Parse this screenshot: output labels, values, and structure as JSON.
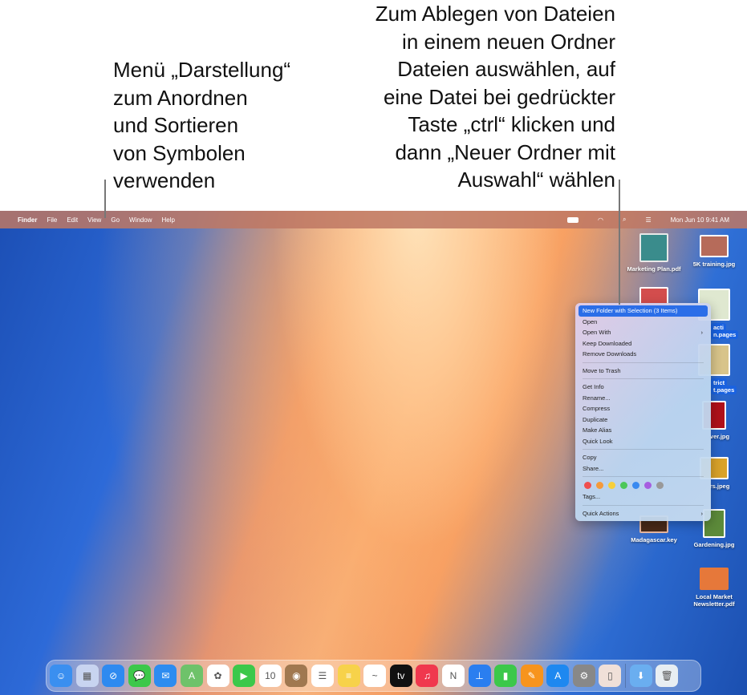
{
  "callouts": {
    "left": [
      "Menü „Darstellung“",
      "zum Anordnen",
      "und Sortieren",
      "von Symbolen",
      "verwenden"
    ],
    "right": [
      "Zum Ablegen von Dateien",
      "in einem neuen Ordner",
      "Dateien auswählen, auf",
      "eine Datei bei gedrückter",
      "Taste „ctrl“ klicken und",
      "dann „Neuer Ordner mit",
      "Auswahl“ wählen"
    ]
  },
  "menubar": {
    "apple": "",
    "app": "Finder",
    "items": [
      "File",
      "Edit",
      "View",
      "Go",
      "Window",
      "Help"
    ],
    "clock": "Mon Jun 10  9:41 AM"
  },
  "desktop_icons": [
    {
      "label": "Marketing Plan.pdf",
      "color": "#3a8c8c"
    },
    {
      "label": "5K training.jpg",
      "color": "#b66b5a"
    },
    {
      "label": "",
      "color": "#d34d4d"
    },
    {
      "label1": "acti",
      "label2": "n.pages",
      "color": "#dfe8d0"
    },
    {
      "label1": "trict",
      "label2": "t.pages",
      "color": "#d8c48a"
    },
    {
      "label": "ver.jpg",
      "color": "#b0101a"
    },
    {
      "label": "rs.jpeg",
      "color": "#d9a22a"
    },
    {
      "label": "Madagascar.key",
      "color": "#4a2a18"
    },
    {
      "label": "Gardening.jpg",
      "color": "#5c8a3a"
    },
    {
      "label": "Local Market Newsletter.pdf",
      "color": "#e6783a"
    }
  ],
  "context_menu": {
    "items": [
      "New Folder with Selection (3 Items)",
      "Open",
      "Open With",
      "Keep Downloaded",
      "Remove Downloads",
      "Move to Trash",
      "Get Info",
      "Rename...",
      "Compress",
      "Duplicate",
      "Make Alias",
      "Quick Look",
      "Copy",
      "Share...",
      "Tags...",
      "Quick Actions"
    ],
    "tag_colors": [
      "#f04e4e",
      "#f59a3a",
      "#f7cf3a",
      "#4cc75a",
      "#3a8af0",
      "#a65ee0",
      "#999999"
    ]
  },
  "dock": [
    {
      "name": "finder",
      "color": "#3a8ff0",
      "glyph": "☺"
    },
    {
      "name": "launchpad",
      "color": "#c8d4f0",
      "glyph": "▦"
    },
    {
      "name": "safari",
      "color": "#2e8af0",
      "glyph": "⊘"
    },
    {
      "name": "messages",
      "color": "#3cc84a",
      "glyph": "💬"
    },
    {
      "name": "mail",
      "color": "#2d8cf0",
      "glyph": "✉"
    },
    {
      "name": "maps",
      "color": "#6ec26a",
      "glyph": "A"
    },
    {
      "name": "photos",
      "color": "#ffffff",
      "glyph": "✿"
    },
    {
      "name": "facetime",
      "color": "#3cc84a",
      "glyph": "▶"
    },
    {
      "name": "calendar",
      "color": "#ffffff",
      "glyph": "10"
    },
    {
      "name": "contacts",
      "color": "#a07850",
      "glyph": "◉"
    },
    {
      "name": "reminders",
      "color": "#ffffff",
      "glyph": "☰"
    },
    {
      "name": "notes",
      "color": "#f7d24a",
      "glyph": "≡"
    },
    {
      "name": "freeform",
      "color": "#ffffff",
      "glyph": "~"
    },
    {
      "name": "tv",
      "color": "#111111",
      "glyph": "tv"
    },
    {
      "name": "music",
      "color": "#f0384e",
      "glyph": "♫"
    },
    {
      "name": "news",
      "color": "#ffffff",
      "glyph": "N"
    },
    {
      "name": "keynote",
      "color": "#2a7ef0",
      "glyph": "⊥"
    },
    {
      "name": "numbers",
      "color": "#3cc84a",
      "glyph": "▮"
    },
    {
      "name": "pages",
      "color": "#f7941d",
      "glyph": "✎"
    },
    {
      "name": "app-store",
      "color": "#1e88f0",
      "glyph": "A"
    },
    {
      "name": "system-settings",
      "color": "#888888",
      "glyph": "⚙"
    },
    {
      "name": "iphone-mirroring",
      "color": "#f0e0d8",
      "glyph": "▯"
    },
    {
      "name": "downloads",
      "color": "#6aaef0",
      "glyph": "⬇"
    },
    {
      "name": "trash",
      "color": "#e8eef2",
      "glyph": "🗑"
    }
  ]
}
